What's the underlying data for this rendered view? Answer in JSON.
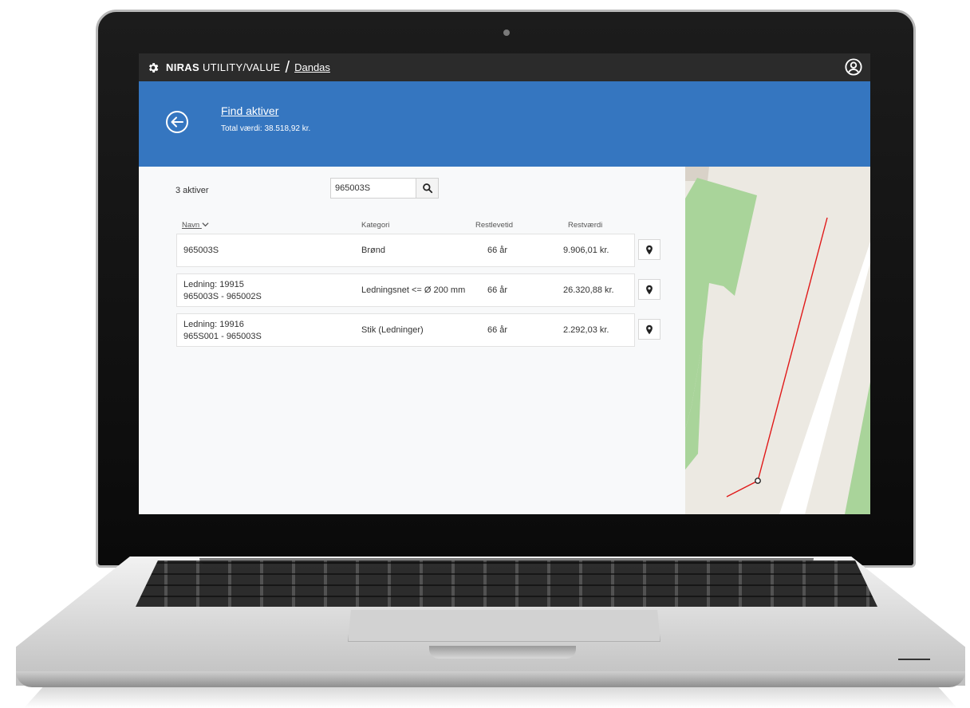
{
  "topbar": {
    "brand_strong": "NIRAS",
    "brand_light": "UTILITY/VALUE",
    "separator": "/",
    "breadcrumb": "Dandas",
    "icons": {
      "logo": "gear-icon",
      "user": "user-circle-icon"
    }
  },
  "header": {
    "title": "Find aktiver",
    "total": "Total værdi: 38.518,92 kr.",
    "back_icon": "arrow-left-circle-icon"
  },
  "results": {
    "count": "3 aktiver",
    "search_value": "965003S",
    "search_icon": "search-icon",
    "columns": {
      "name": "Navn",
      "category": "Kategori",
      "lifetime": "Restlevetid",
      "value": "Restværdi"
    },
    "sort_icon": "chevron-down-icon",
    "rows": [
      {
        "name1": "965003S",
        "name2": "",
        "category": "Brønd",
        "lifetime": "66 år",
        "value": "9.906,01 kr."
      },
      {
        "name1": "Ledning: 19915",
        "name2": "965003S - 965002S",
        "category": "Ledningsnet <= Ø 200 mm",
        "lifetime": "66 år",
        "value": "26.320,88 kr."
      },
      {
        "name1": "Ledning: 19916",
        "name2": "965S001 - 965003S",
        "category": "Stik (Ledninger)",
        "lifetime": "66 år",
        "value": "2.292,03 kr."
      }
    ],
    "row_action_icon": "map-pin-icon"
  },
  "colors": {
    "topbar": "#2b2b2b",
    "header": "#3576c0",
    "map_background": "#ece9e2",
    "map_green": "#a9d49a",
    "pipe": "#e01919"
  }
}
